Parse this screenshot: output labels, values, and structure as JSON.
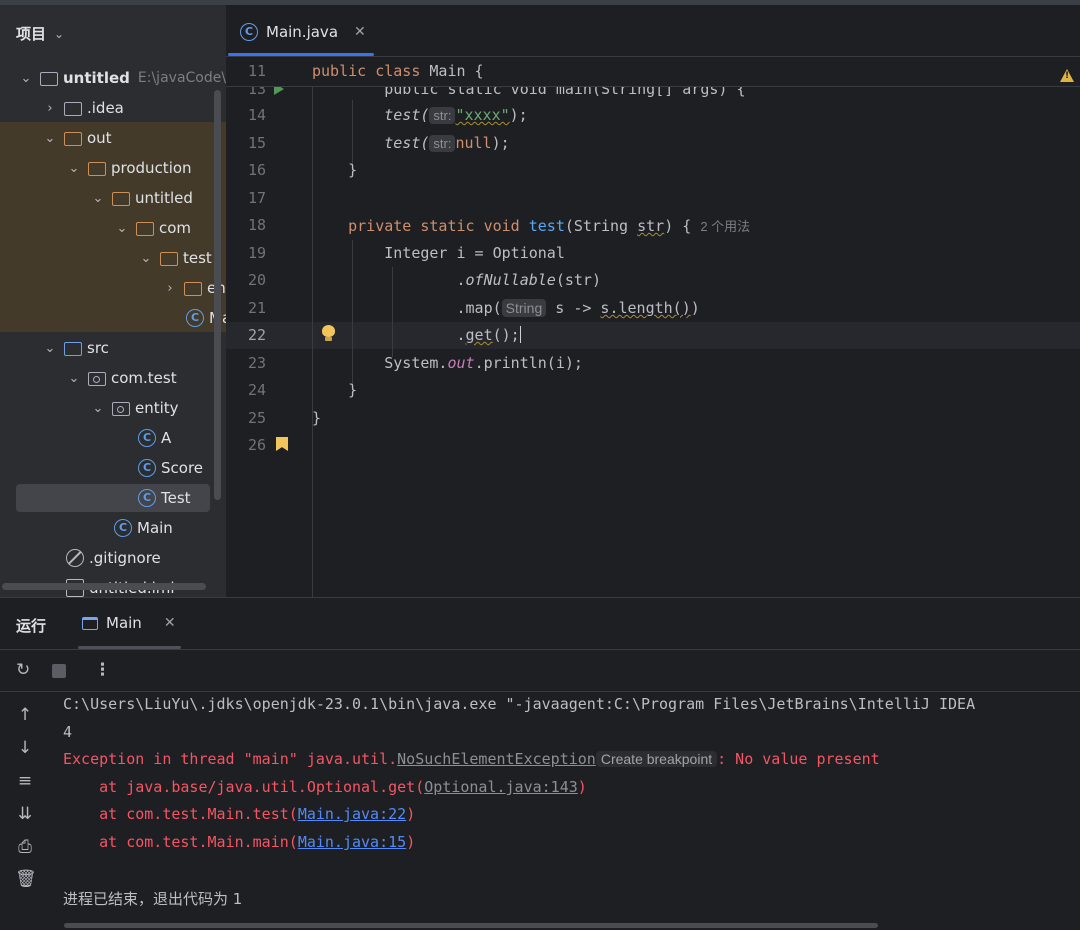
{
  "project": {
    "title": "项目",
    "tree": [
      {
        "label": "untitled",
        "path": "E:\\javaCode\\u",
        "bold": true
      },
      {
        "label": ".idea"
      },
      {
        "label": "out"
      },
      {
        "label": "production"
      },
      {
        "label": "untitled"
      },
      {
        "label": "com"
      },
      {
        "label": "test"
      },
      {
        "label": "en"
      },
      {
        "label": "Ma"
      },
      {
        "label": "src"
      },
      {
        "label": "com.test"
      },
      {
        "label": "entity"
      },
      {
        "label": "A"
      },
      {
        "label": "Score"
      },
      {
        "label": "Test"
      },
      {
        "label": "Main"
      },
      {
        "label": ".gitignore"
      },
      {
        "label": "untitled.iml"
      }
    ]
  },
  "editor": {
    "tab_label": "Main.java",
    "line_numbers": [
      "11",
      "13",
      "14",
      "15",
      "16",
      "17",
      "18",
      "19",
      "20",
      "21",
      "22",
      "23",
      "24",
      "25",
      "26"
    ],
    "hints": {
      "str1": "str:",
      "str2": "str:",
      "string": "String",
      "usages": "2 个用法"
    },
    "lines": {
      "l11_a": "public class",
      "l11_b": " Main {",
      "l13": "    public static void main(String[] args) {",
      "l14_a": "        test(",
      "l14_b": "\"xxxx\"",
      "l14_c": ");",
      "l15_a": "        test(",
      "l15_b": "null",
      "l15_c": ");",
      "l16": "    }",
      "l18_a": "    private static void",
      "l18_b": " test",
      "l18_c": "(String ",
      "l18_d": "str",
      "l18_e": ") {",
      "l19": "        Integer i = Optional",
      "l20_a": "                .",
      "l20_b": "ofNullable",
      "l20_c": "(str)",
      "l21_a": "                .map(",
      "l21_b": "s -> ",
      "l21_c": "s.length()",
      "l21_d": ")",
      "l22_a": "                .",
      "l22_b": "get",
      "l22_c": "();",
      "l23_a": "        System.",
      "l23_b": "out",
      "l23_c": ".println(i);",
      "l24": "    }",
      "l25": "}"
    }
  },
  "run": {
    "title": "运行",
    "tab_label": "Main",
    "console": {
      "cmd": "C:\\Users\\LiuYu\\.jdks\\openjdk-23.0.1\\bin\\java.exe \"-javaagent:C:\\Program Files\\JetBrains\\IntelliJ IDEA",
      "out": "4",
      "exc_a": "Exception in thread \"main\" java.util.",
      "exc_b": "NoSuchElementException",
      "exc_hint": "Create breakpoint",
      "exc_c": ": No value present",
      "at1_a": "    at java.base/java.util.Optional.get(",
      "at1_link": "Optional.java:143",
      "at1_c": ")",
      "at2_a": "    at com.test.Main.test(",
      "at2_link": "Main.java:22",
      "at2_c": ")",
      "at3_a": "    at com.test.Main.main(",
      "at3_link": "Main.java:15",
      "at3_c": ")",
      "exit": "进程已结束，退出代码为 1"
    }
  },
  "colors": {
    "keyword": "#cf8e6d",
    "function": "#56a8f5",
    "string": "#6aab73",
    "error": "#f75464",
    "link": "#548af7",
    "accent": "#3574f0"
  }
}
